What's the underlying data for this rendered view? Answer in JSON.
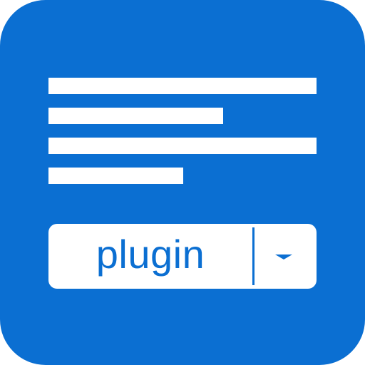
{
  "app_icon": {
    "background_color": "#0b6fd2",
    "foreground_color": "#ffffff",
    "text_lines_icon": "document-lines-icon",
    "dropdown": {
      "selected_value": "plugin",
      "arrow_icon": "chevron-down-icon"
    }
  }
}
